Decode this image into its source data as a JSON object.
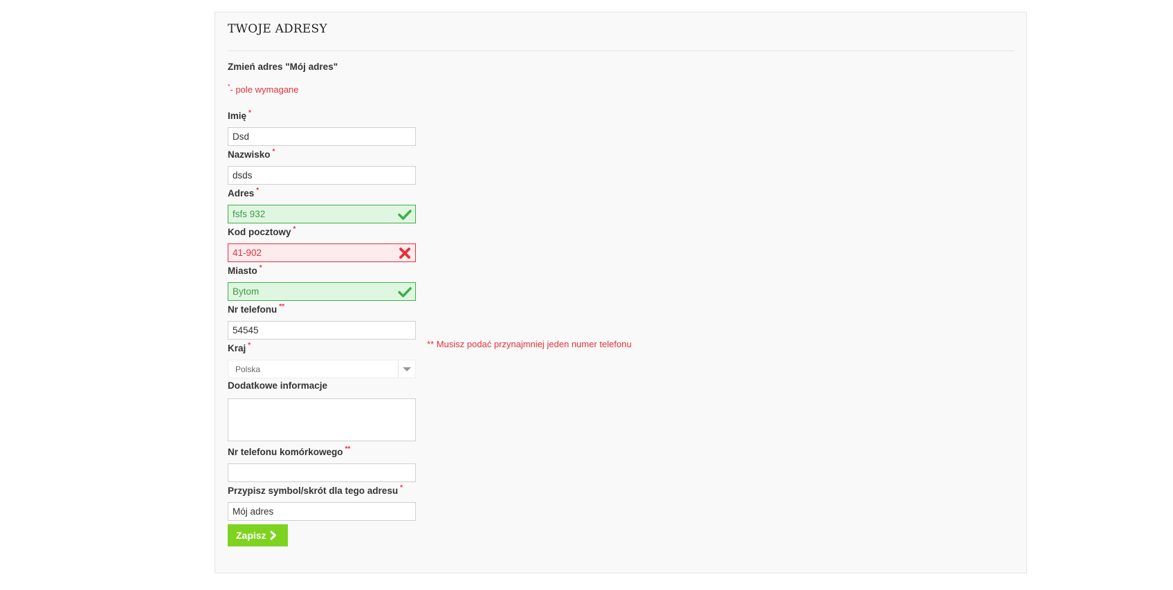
{
  "panel": {
    "title": "TWOJE ADRESY",
    "subtitle": "Zmień adres \"Mój adres\"",
    "required_marker": "*",
    "required_note": "- pole wymagane"
  },
  "fields": {
    "first_name": {
      "label": "Imię",
      "marker": "*",
      "value": "Dsd"
    },
    "last_name": {
      "label": "Nazwisko",
      "marker": "*",
      "value": "dsds"
    },
    "address": {
      "label": "Adres",
      "marker": "*",
      "value": "fsfs 932",
      "status": "valid"
    },
    "postcode": {
      "label": "Kod pocztowy",
      "marker": "*",
      "value": "41-902",
      "status": "invalid"
    },
    "city": {
      "label": "Miasto",
      "marker": "*",
      "value": "Bytom",
      "status": "valid"
    },
    "phone": {
      "label": "Nr telefonu",
      "marker": "**",
      "value": "54545",
      "error": "** Musisz podać przynajmniej jeden numer telefonu"
    },
    "country": {
      "label": "Kraj",
      "marker": "*",
      "selected": "Polska"
    },
    "other": {
      "label": "Dodatkowe informacje",
      "value": ""
    },
    "mobile": {
      "label": "Nr telefonu komórkowego",
      "marker": "**",
      "value": ""
    },
    "alias": {
      "label": "Przypisz symbol/skrót dla tego adresu",
      "marker": "*",
      "value": "Mój adres"
    }
  },
  "actions": {
    "save_label": "Zapisz"
  },
  "colors": {
    "required": "#e8303a",
    "valid_bg": "#dff7e0",
    "valid_border": "#3fae4a",
    "invalid_bg": "#fdecee",
    "button": "#7ed321"
  },
  "icons": {
    "valid": "check-icon",
    "invalid": "cross-icon",
    "button": "chevron-right-icon",
    "select": "caret-down-icon"
  }
}
